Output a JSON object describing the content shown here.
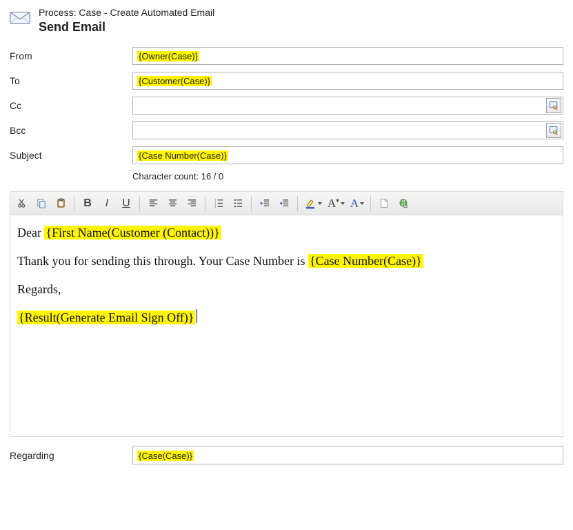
{
  "header": {
    "process": "Process: Case - Create Automated Email",
    "action": "Send Email"
  },
  "fields": {
    "from": {
      "label": "From",
      "value": "{Owner(Case)}"
    },
    "to": {
      "label": "To",
      "value": "{Customer(Case)}"
    },
    "cc": {
      "label": "Cc",
      "value": ""
    },
    "bcc": {
      "label": "Bcc",
      "value": ""
    },
    "subject": {
      "label": "Subject",
      "value": "{Case Number(Case)}"
    },
    "regarding": {
      "label": "Regarding",
      "value": "{Case(Case)}"
    }
  },
  "char_count": "Character count: 16 / 0",
  "body": {
    "dear_prefix": "Dear  ",
    "first_name_token": "{First Name(Customer (Contact))}",
    "line2a": "Thank you for sending this through. Your Case Number is ",
    "case_token": "{Case Number(Case)}",
    "regards": "Regards,",
    "signoff_token": "{Result(Generate Email Sign Off)}"
  }
}
